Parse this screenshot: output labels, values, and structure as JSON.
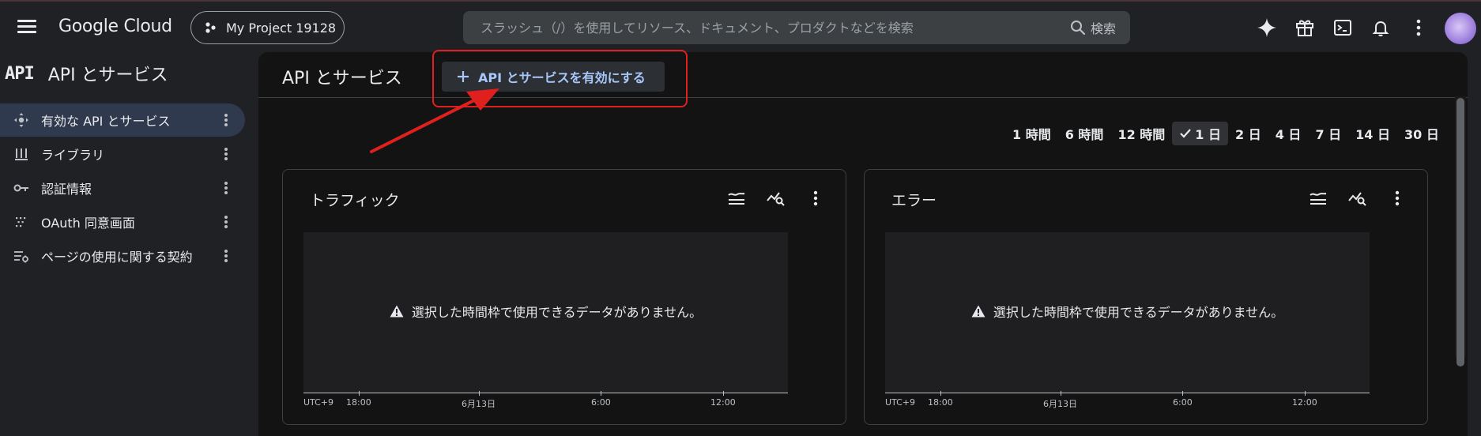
{
  "topbar": {
    "logo": "Google Cloud",
    "project_name": "My Project 19128",
    "search_placeholder": "スラッシュ（/）を使用してリソース、ドキュメント、プロダクトなどを検索",
    "search_button": "検索",
    "icons": [
      "gemini-icon",
      "gift-icon",
      "cloud-shell-icon",
      "notifications-icon",
      "more-vert-icon"
    ]
  },
  "sidebar": {
    "glyph": "API",
    "title": "API とサービス",
    "items": [
      {
        "label": "有効な API とサービス",
        "icon": "enabled-apis-icon",
        "active": true
      },
      {
        "label": "ライブラリ",
        "icon": "library-icon",
        "active": false
      },
      {
        "label": "認証情報",
        "icon": "key-icon",
        "active": false
      },
      {
        "label": "OAuth 同意画面",
        "icon": "oauth-consent-icon",
        "active": false
      },
      {
        "label": "ページの使用に関する契約",
        "icon": "page-usage-agreements-icon",
        "active": false
      }
    ]
  },
  "main": {
    "title": "API とサービス",
    "enable_button": "API とサービスを有効にする",
    "time_ranges": [
      "1 時間",
      "6 時間",
      "12 時間",
      "1 日",
      "2 日",
      "4 日",
      "7 日",
      "14 日",
      "30 日"
    ],
    "active_range": "1 日",
    "cards": [
      {
        "title": "トラフィック",
        "no_data": "選択した時間枠で使用できるデータがありません。",
        "timezone": "UTC+9",
        "ticks": [
          "18:00",
          "6月13日",
          "6:00",
          "12:00"
        ]
      },
      {
        "title": "エラー",
        "no_data": "選択した時間枠で使用できるデータがありません。",
        "timezone": "UTC+9",
        "ticks": [
          "18:00",
          "6月13日",
          "6:00",
          "12:00"
        ]
      }
    ]
  },
  "colors": {
    "accent": "#a8c7fa",
    "active_nav_bg": "#2f3a4e",
    "annotation": "#e0201e",
    "background": "#202124",
    "panel": "#131313"
  }
}
